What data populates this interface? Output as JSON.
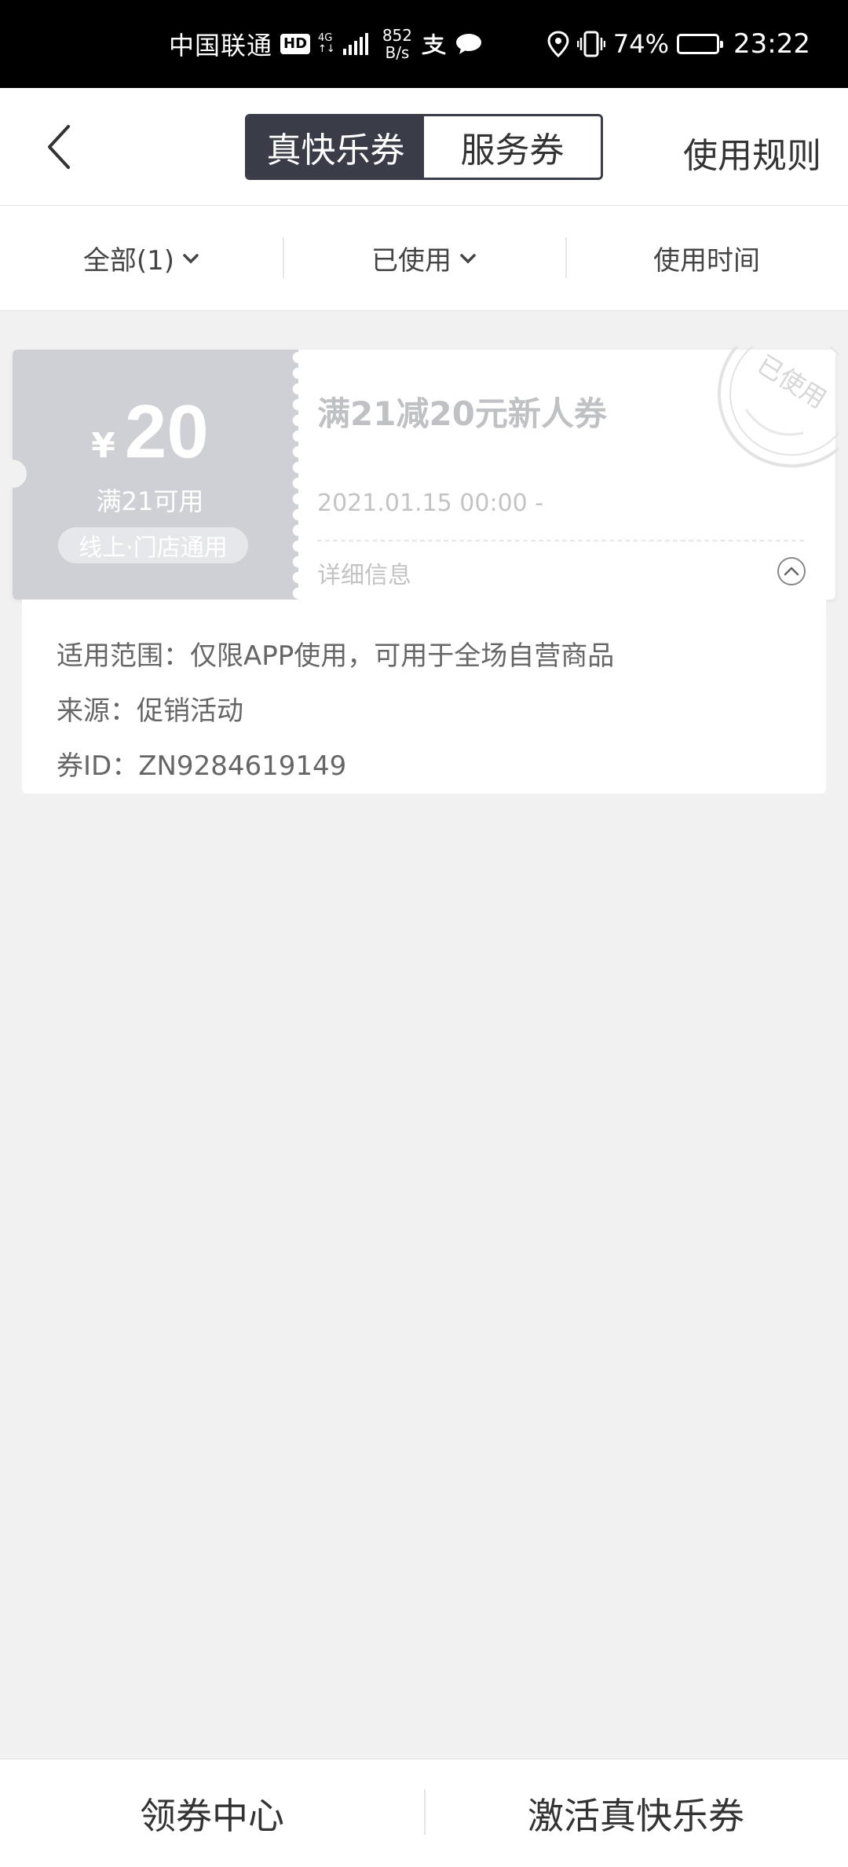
{
  "status_bar": {
    "carrier": "中国联通",
    "hd": "HD",
    "network_top": "4G",
    "network_bottom": "↑↓",
    "speed_value": "852",
    "speed_unit": "B/s",
    "battery_percent": "74%",
    "battery_level": 0.74,
    "time": "23:22"
  },
  "header": {
    "tabs": [
      {
        "label": "真快乐券",
        "active": true
      },
      {
        "label": "服务券",
        "active": false
      }
    ],
    "rules_link": "使用规则"
  },
  "filters": [
    {
      "label": "全部(1)",
      "has_dropdown": true
    },
    {
      "label": "已使用",
      "has_dropdown": true
    },
    {
      "label": "使用时间",
      "has_dropdown": false
    }
  ],
  "coupon": {
    "currency_symbol": "¥",
    "amount": "20",
    "condition": "满21可用",
    "scope": "线上·门店通用",
    "title": "满21减20元新人券",
    "date_range": "2021.01.15 00:00 -",
    "detail_link": "详细信息",
    "stamp_text": "已使用"
  },
  "details": {
    "usage_scope": "适用范围：仅限APP使用，可用于全场自营商品",
    "source": "来源：促销活动",
    "coupon_id": "券ID：ZN9284619149"
  },
  "bottom_bar": {
    "left_button": "领券中心",
    "right_button": "激活真快乐券"
  },
  "colors": {
    "tab_active_bg": "#3a3d48",
    "coupon_used_bg": "#ced0d5",
    "page_bg": "#f1f1f1"
  }
}
